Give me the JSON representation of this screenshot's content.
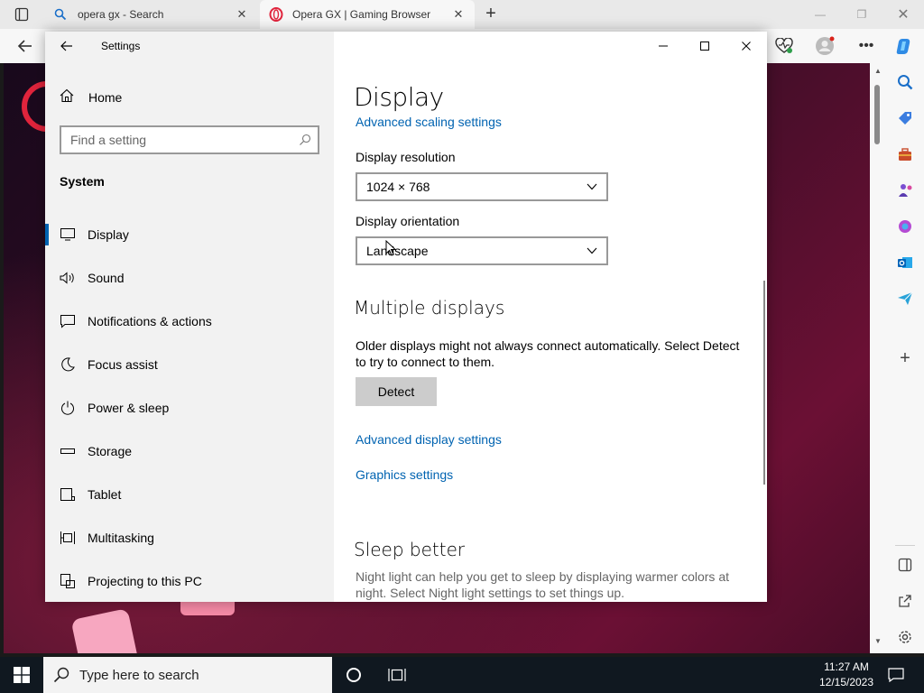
{
  "browser": {
    "tabs": [
      {
        "title": "opera gx - Search",
        "icon": "search-icon"
      },
      {
        "title": "Opera GX | Gaming Browser",
        "icon": "opera-icon"
      }
    ]
  },
  "settings": {
    "app_title": "Settings",
    "home_label": "Home",
    "search_placeholder": "Find a setting",
    "section_label": "System",
    "nav_items": [
      {
        "label": "Display",
        "icon": "monitor-icon",
        "selected": true
      },
      {
        "label": "Sound",
        "icon": "speaker-icon"
      },
      {
        "label": "Notifications & actions",
        "icon": "notification-icon"
      },
      {
        "label": "Focus assist",
        "icon": "moon-icon"
      },
      {
        "label": "Power & sleep",
        "icon": "power-icon"
      },
      {
        "label": "Storage",
        "icon": "storage-icon"
      },
      {
        "label": "Tablet",
        "icon": "tablet-icon"
      },
      {
        "label": "Multitasking",
        "icon": "multitasking-icon"
      },
      {
        "label": "Projecting to this PC",
        "icon": "projecting-icon"
      }
    ],
    "page_title": "Display",
    "advanced_scaling_link": "Advanced scaling settings",
    "resolution_label": "Display resolution",
    "resolution_value": "1024 × 768",
    "orientation_label": "Display orientation",
    "orientation_value": "Landscape",
    "multiple_displays_heading": "Multiple displays",
    "multiple_displays_text": "Older displays might not always connect automatically. Select Detect to try to connect to them.",
    "detect_button": "Detect",
    "advanced_display_link": "Advanced display settings",
    "graphics_link": "Graphics settings",
    "sleep_heading": "Sleep better",
    "sleep_text": "Night light can help you get to sleep by displaying warmer colors at night. Select Night light settings to set things up."
  },
  "taskbar": {
    "search_placeholder": "Type here to search",
    "time": "11:27 AM",
    "date": "12/15/2023"
  },
  "colors": {
    "accent": "#0063b1",
    "taskbar": "#101820",
    "opera_red": "#e0243c"
  }
}
